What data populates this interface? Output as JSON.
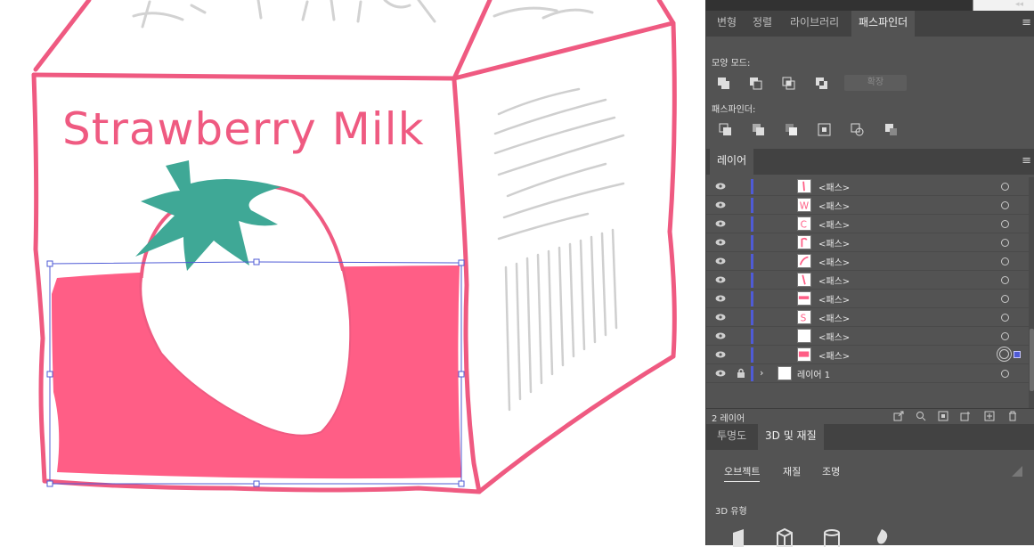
{
  "artwork": {
    "title_text": "Strawberry Milk",
    "colors": {
      "outline": "#ef5a81",
      "fill": "#ff5e86",
      "leaf": "#3fa896",
      "sketch": "#c8c8c8",
      "selection": "#4f5bd6"
    }
  },
  "panel": {
    "tabs": [
      "변형",
      "정렬",
      "라이브러리",
      "패스파인더"
    ],
    "active_tab": "패스파인더",
    "shape_modes_label": "모양 모드:",
    "expand_button": "확장",
    "pathfinders_label": "패스파인더:",
    "layers_tab": "레이어",
    "layer_rows": [
      {
        "name": "<패스>",
        "thumb": "stroke-i"
      },
      {
        "name": "<패스>",
        "thumb": "W"
      },
      {
        "name": "<패스>",
        "thumb": "C"
      },
      {
        "name": "<패스>",
        "thumb": "stroke-r"
      },
      {
        "name": "<패스>",
        "thumb": "arc"
      },
      {
        "name": "<패스>",
        "thumb": "stroke-t"
      },
      {
        "name": "<패스>",
        "thumb": "band"
      },
      {
        "name": "<패스>",
        "thumb": "S"
      },
      {
        "name": "<패스>",
        "thumb": "blank"
      },
      {
        "name": "<패스>",
        "thumb": "fill",
        "selected": true
      }
    ],
    "parent_layer": "레이어 1",
    "layer_count": "2 레이어",
    "bottom_tabs": [
      "투명도",
      "3D 및 재질"
    ],
    "active_bottom_tab": "3D 및 재질",
    "subtabs": [
      "오브젝트",
      "재질",
      "조명"
    ],
    "active_subtab": "오브젝트",
    "type_label": "3D 유형"
  }
}
